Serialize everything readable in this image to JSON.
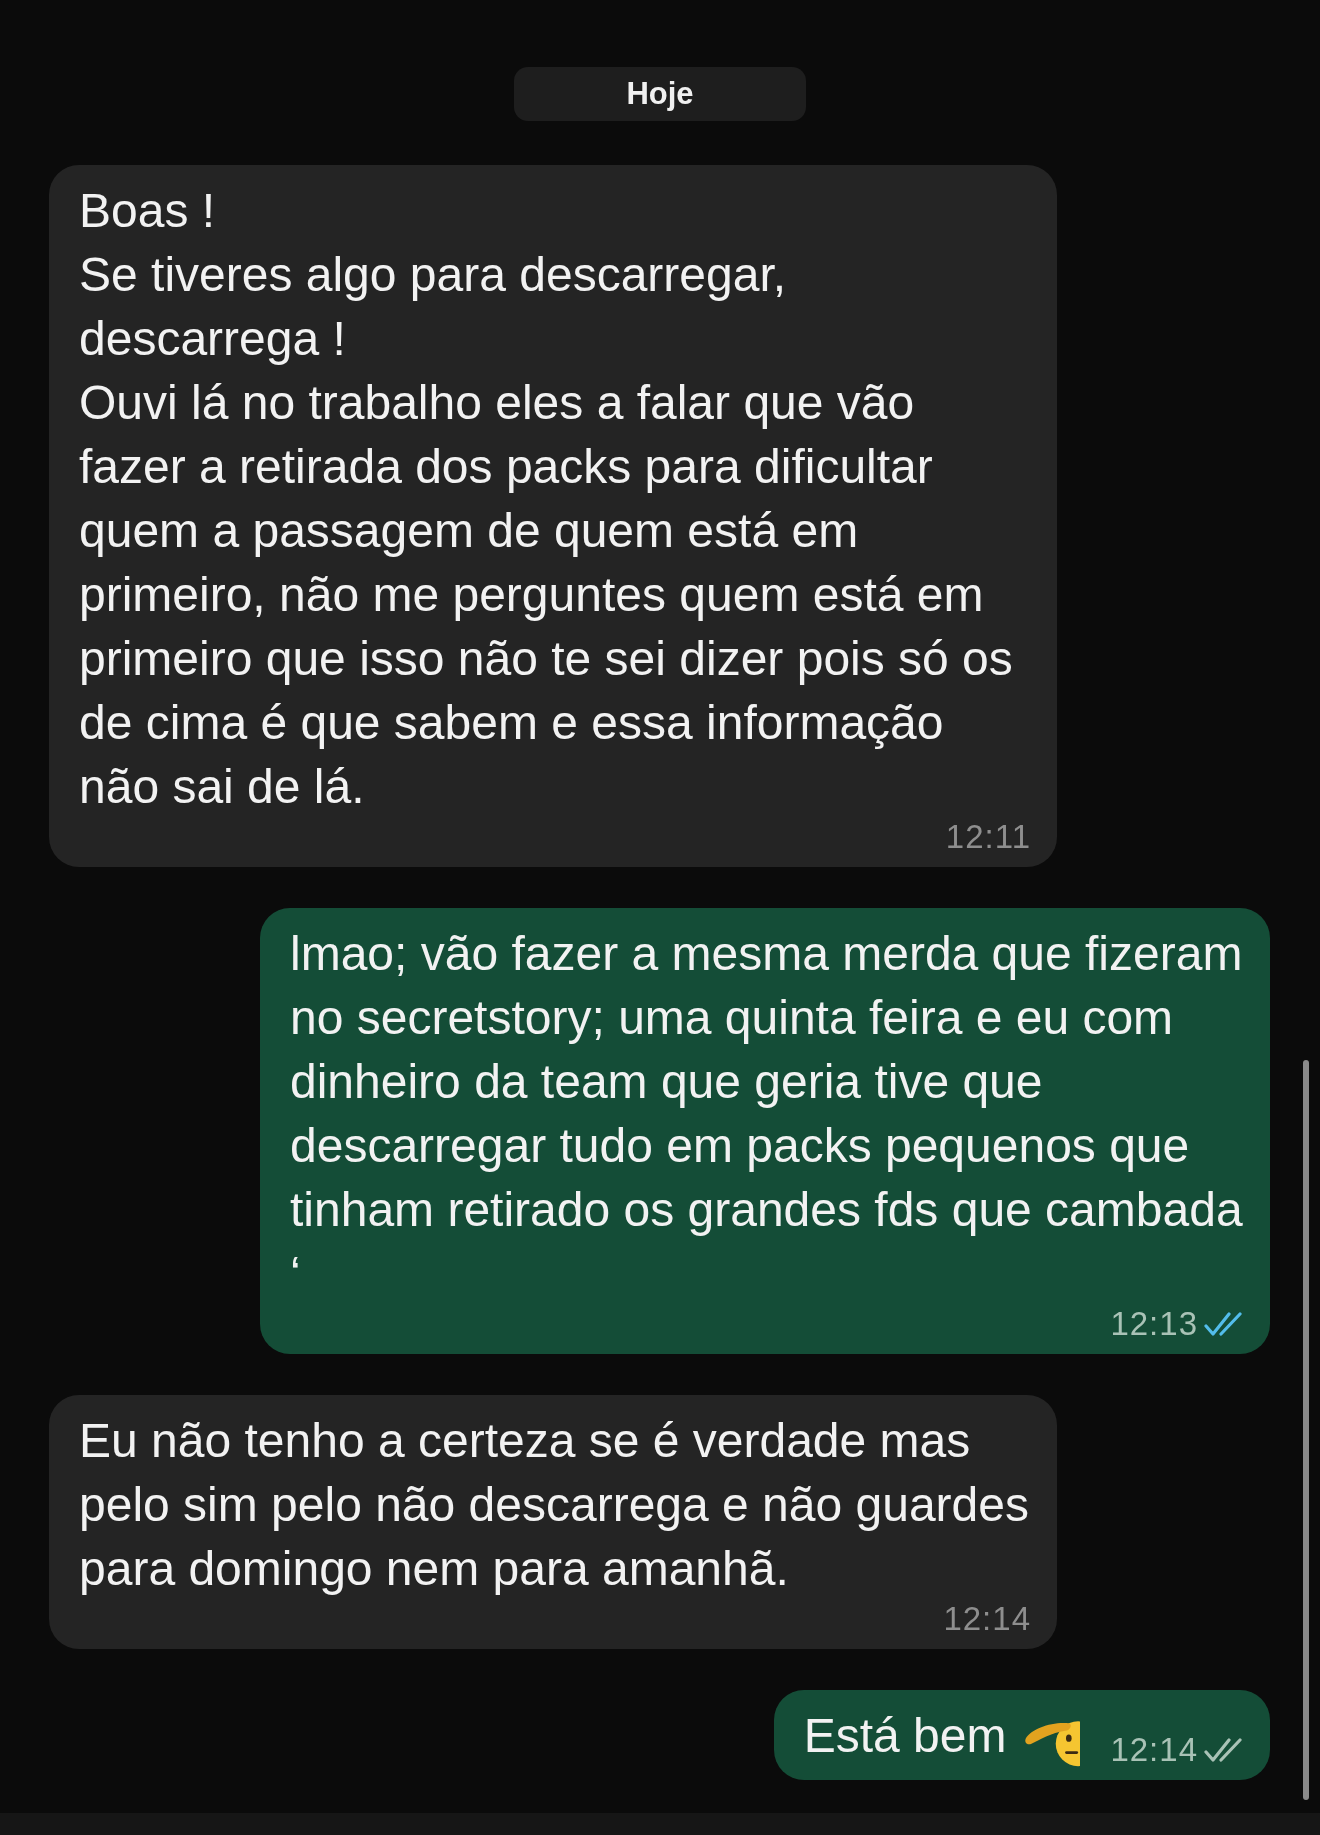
{
  "date_divider": "Hoje",
  "messages": [
    {
      "outgoing": false,
      "text": "Boas !\nSe tiveres algo para descarregar, descarrega !\nOuvi lá no trabalho eles a falar que vão fazer a retirada dos packs para dificultar quem a passagem de quem está em primeiro, não me perguntes quem está em primeiro que isso não te sei dizer pois só os de cima é que sabem e essa informação não sai de lá.",
      "time": "12:11"
    },
    {
      "outgoing": true,
      "text": "lmao; vão fazer a mesma merda que fizeram no secretstory; uma quinta feira e eu com dinheiro da team que geria tive que descarregar tudo em packs pequenos que tinham retirado os grandes fds que cambada ‘",
      "time": "12:13",
      "read": true
    },
    {
      "outgoing": false,
      "text": "Eu não tenho a certeza se é verdade mas pelo sim pelo não descarrega e não guardes para domingo nem para amanhã.",
      "time": "12:14"
    },
    {
      "outgoing": true,
      "text": "Está bem",
      "trailing_emoji": true,
      "time": "12:14",
      "read": false
    }
  ]
}
